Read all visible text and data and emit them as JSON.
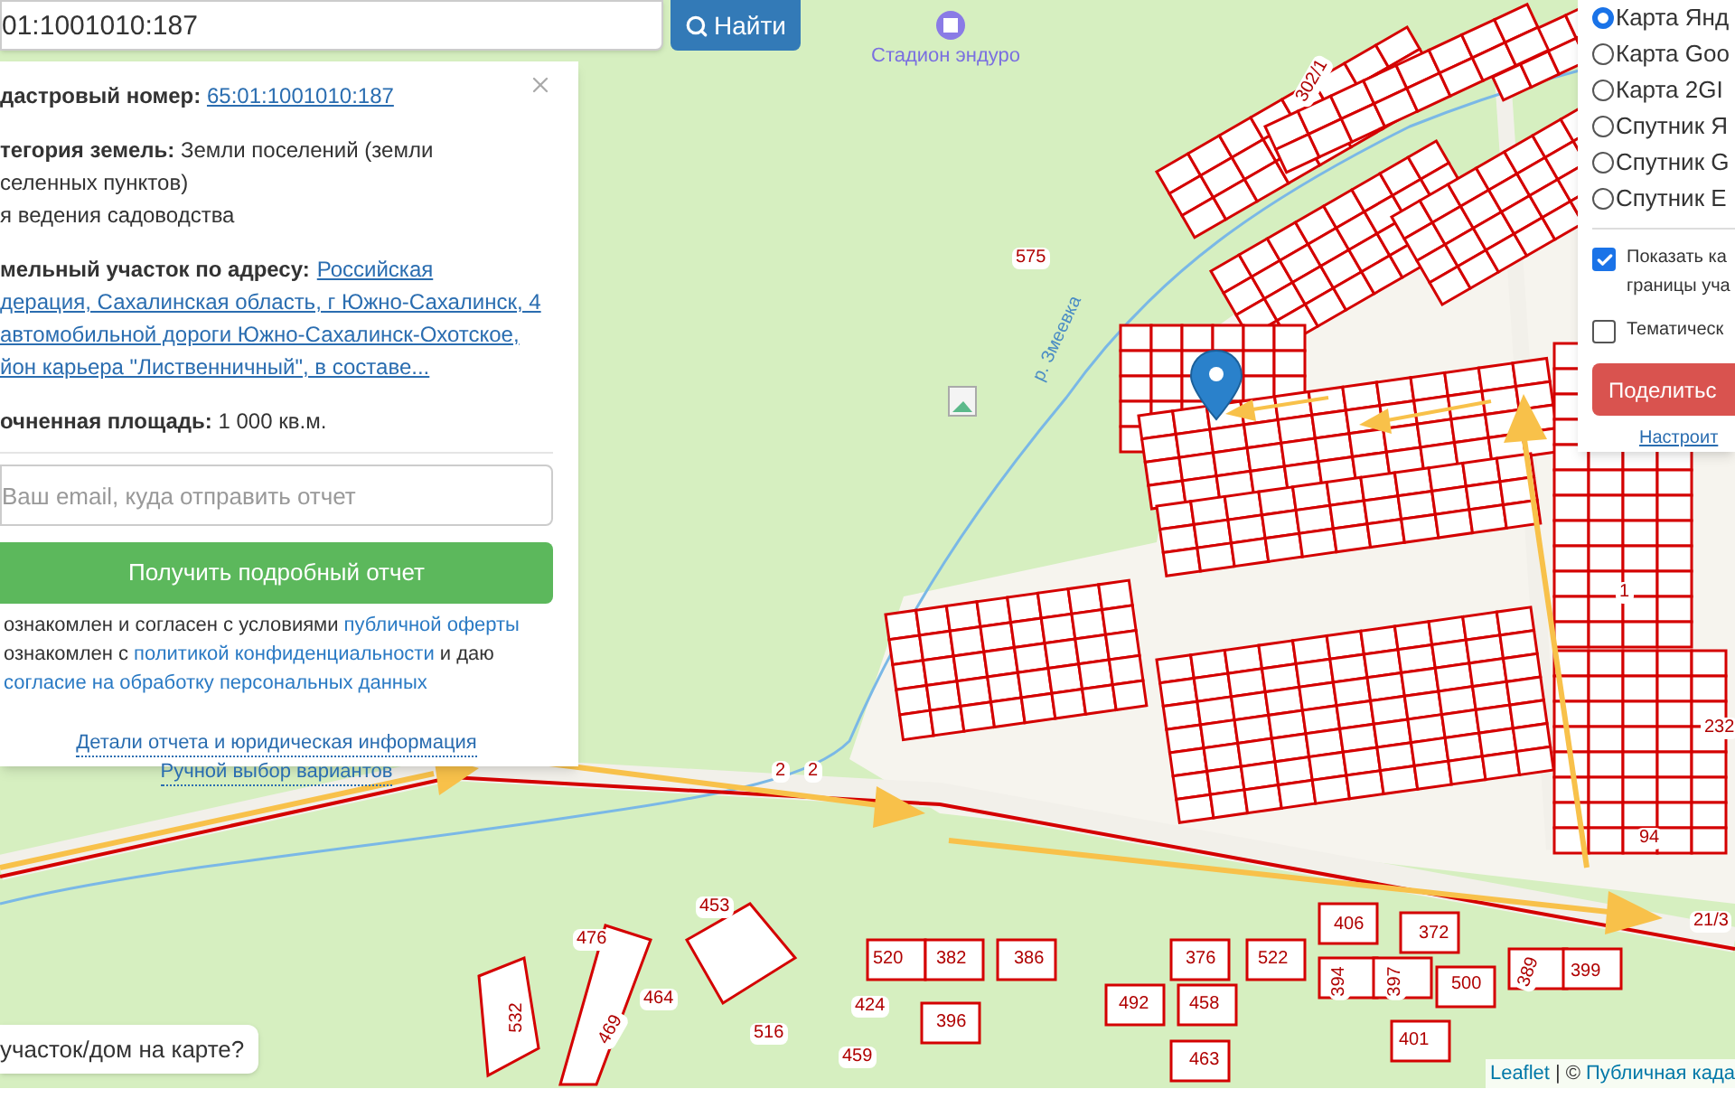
{
  "search": {
    "value": "01:1001010:187",
    "button": "Найти"
  },
  "info_panel": {
    "cadastral": {
      "label": "дастровый номер:",
      "link": "65:01:1001010:187"
    },
    "category": {
      "lines": [
        "**тегория земель:** Земли поселений (земли",
        "селенных пунктов)",
        "я ведения садоводства"
      ]
    },
    "address": {
      "label": "мельный участок по адресу:",
      "link_lines": [
        "Российская",
        "дерация, Сахалинская область, г Южно-Сахалинск, 4",
        "автомобильной дороги Южно-Сахалинск-Охотское,",
        "йон карьера \"Лиственничный\", в составе..."
      ]
    },
    "area": "**очненная площадь:** 1 000 кв.м.",
    "email": {
      "placeholder": "Ваш email, куда отправить отчет"
    },
    "report_button": "Получить подробный отчет",
    "consent_lines": [
      [
        {
          "kind": "text",
          "text": "ознакомлен и согласен с условиями"
        },
        {
          "kind": "link",
          "text": "публичной оферты"
        }
      ],
      [
        {
          "kind": "text",
          "text": "ознакомлен с"
        },
        {
          "kind": "link",
          "text": "политикой конфиденциальности"
        },
        {
          "kind": "text",
          "text": "и даю"
        }
      ],
      [
        {
          "kind": "link",
          "text": "согласие на обработку персональных данных"
        }
      ]
    ],
    "footer_links": [
      "Детали отчета и юридическая информация",
      "Ручной выбор вариантов"
    ]
  },
  "layers_panel": {
    "base_layers": [
      {
        "label": "Карта Янд",
        "selected": true
      },
      {
        "label": "Карта Goo",
        "selected": false
      },
      {
        "label": "Карта 2GI",
        "selected": false
      },
      {
        "label": "Спутник Я",
        "selected": false
      },
      {
        "label": "Спутник G",
        "selected": false
      },
      {
        "label": "Спутник E",
        "selected": false
      }
    ],
    "overlays": [
      {
        "lines": [
          "Показать ка",
          "границы уча"
        ],
        "checked": true
      },
      {
        "lines": [
          "Тематическ"
        ],
        "checked": false
      }
    ],
    "share_button": "Поделитьс",
    "settings_link": "Настроит"
  },
  "map": {
    "place": "Стадион эндуро",
    "river": "р. Змеевка",
    "parcel_labels": [
      "575",
      "302/1",
      "453",
      "476",
      "464",
      "532",
      "469",
      "516",
      "459",
      "424",
      "520",
      "382",
      "386",
      "396",
      "376",
      "522",
      "492",
      "458",
      "463",
      "406",
      "372",
      "394",
      "397",
      "500",
      "389",
      "399",
      "401",
      "94",
      "21/3",
      "232",
      "1",
      "2",
      "2"
    ]
  },
  "help_bubble": "участок/дом на карте?",
  "attribution": {
    "link": "Leaflet",
    "separator": "|",
    "copyright": "©",
    "source": "Публичная када"
  }
}
